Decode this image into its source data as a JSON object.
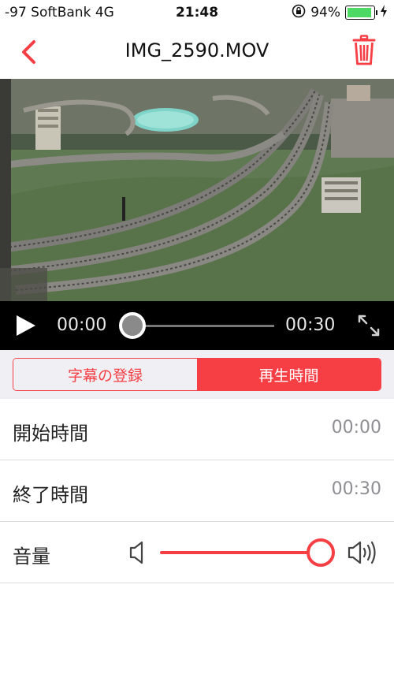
{
  "status_bar": {
    "carrier": "-97 SoftBank  4G",
    "time": "21:48",
    "battery_percent": "94%",
    "battery_level": 0.94
  },
  "nav": {
    "title": "IMG_2590.MOV",
    "back_icon": "chevron-left-icon",
    "trash_icon": "trash-icon"
  },
  "player": {
    "current_time": "00:00",
    "duration": "00:30",
    "progress": 0.0,
    "play_icon": "play-icon",
    "expand_icon": "expand-icon"
  },
  "segments": {
    "items": [
      {
        "label": "字幕の登録",
        "active": false
      },
      {
        "label": "再生時間",
        "active": true
      }
    ]
  },
  "settings": {
    "start_label": "開始時間",
    "start_value": "00:00",
    "end_label": "終了時間",
    "end_value": "00:30",
    "volume_label": "音量",
    "volume_level": 1.0
  },
  "colors": {
    "accent": "#f53f45",
    "battery": "#4cd964",
    "background": "#efeff4"
  }
}
